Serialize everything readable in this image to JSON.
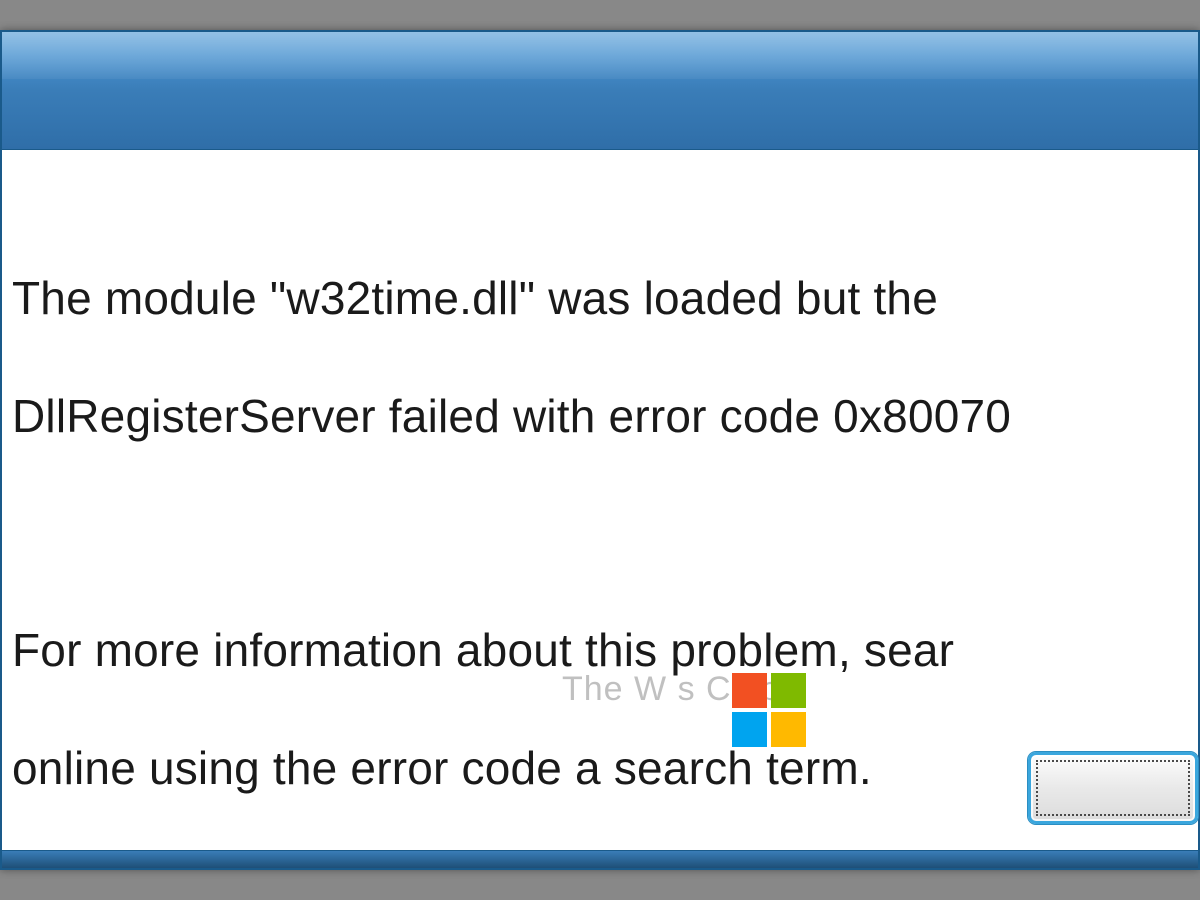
{
  "dialog": {
    "title": "",
    "message": {
      "line1": "The module \"w32time.dll\" was loaded but the",
      "line2": "DllRegisterServer failed with error code 0x80070",
      "line3": "For more information about this problem, sear",
      "line4": "online using the error code a       search term."
    },
    "ok_label": ""
  },
  "watermark": {
    "text": "The W        s Club"
  },
  "icons": {
    "ms_logo": "microsoft-logo-icon"
  },
  "colors": {
    "titlebar_top": "#5aa0d8",
    "titlebar_bottom": "#2f6ea8",
    "frame": "#1a5a8a",
    "button_focus": "#3aa6dd",
    "logo_red": "#f25022",
    "logo_green": "#7fba00",
    "logo_blue": "#00a4ef",
    "logo_yellow": "#ffb900"
  }
}
